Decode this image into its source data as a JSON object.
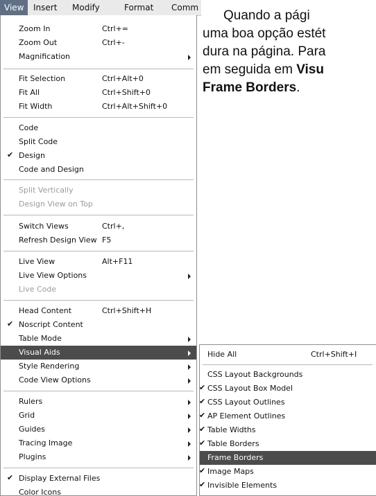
{
  "menubar": {
    "items": [
      "View",
      "Insert",
      "Modify",
      "Format",
      "Comm"
    ]
  },
  "view_menu": {
    "items": [
      {
        "label": "Zoom In",
        "shortcut": "Ctrl+="
      },
      {
        "label": "Zoom Out",
        "shortcut": "Ctrl+-"
      },
      {
        "label": "Magnification",
        "shortcut": ""
      },
      {
        "label": "Fit Selection",
        "shortcut": "Ctrl+Alt+0"
      },
      {
        "label": "Fit All",
        "shortcut": "Ctrl+Shift+0"
      },
      {
        "label": "Fit Width",
        "shortcut": "Ctrl+Alt+Shift+0"
      },
      {
        "label": "Code",
        "shortcut": ""
      },
      {
        "label": "Split Code",
        "shortcut": ""
      },
      {
        "label": "Design",
        "shortcut": ""
      },
      {
        "label": "Code and Design",
        "shortcut": ""
      },
      {
        "label": "Split Vertically",
        "shortcut": ""
      },
      {
        "label": "Design View on Top",
        "shortcut": ""
      },
      {
        "label": "Switch Views",
        "shortcut": "Ctrl+,"
      },
      {
        "label": "Refresh Design View",
        "shortcut": "F5"
      },
      {
        "label": "Live View",
        "shortcut": "Alt+F11"
      },
      {
        "label": "Live View Options",
        "shortcut": ""
      },
      {
        "label": "Live Code",
        "shortcut": ""
      },
      {
        "label": "Head Content",
        "shortcut": "Ctrl+Shift+H"
      },
      {
        "label": "Noscript Content",
        "shortcut": ""
      },
      {
        "label": "Table Mode",
        "shortcut": ""
      },
      {
        "label": "Visual Aids",
        "shortcut": ""
      },
      {
        "label": "Style Rendering",
        "shortcut": ""
      },
      {
        "label": "Code View Options",
        "shortcut": ""
      },
      {
        "label": "Rulers",
        "shortcut": ""
      },
      {
        "label": "Grid",
        "shortcut": ""
      },
      {
        "label": "Guides",
        "shortcut": ""
      },
      {
        "label": "Tracing Image",
        "shortcut": ""
      },
      {
        "label": "Plugins",
        "shortcut": ""
      },
      {
        "label": "Display External Files",
        "shortcut": ""
      },
      {
        "label": "Color Icons",
        "shortcut": ""
      }
    ]
  },
  "visual_aids_menu": {
    "items": [
      {
        "label": "Hide All",
        "shortcut": "Ctrl+Shift+I"
      },
      {
        "label": "CSS Layout Backgrounds",
        "shortcut": ""
      },
      {
        "label": "CSS Layout Box Model",
        "shortcut": ""
      },
      {
        "label": "CSS Layout Outlines",
        "shortcut": ""
      },
      {
        "label": "AP Element Outlines",
        "shortcut": ""
      },
      {
        "label": "Table Widths",
        "shortcut": ""
      },
      {
        "label": "Table Borders",
        "shortcut": ""
      },
      {
        "label": "Frame Borders",
        "shortcut": ""
      },
      {
        "label": "Image Maps",
        "shortcut": ""
      },
      {
        "label": "Invisible Elements",
        "shortcut": ""
      }
    ]
  },
  "checkmark": "✔",
  "paragraph": {
    "line1": "Quando a pági",
    "line2": "uma boa opção estét",
    "line3": "dura na página. Para",
    "line4_text": "em seguida em ",
    "line4_bold": "Visu",
    "line5_bold": "Frame Borders",
    "line5_end": "."
  }
}
